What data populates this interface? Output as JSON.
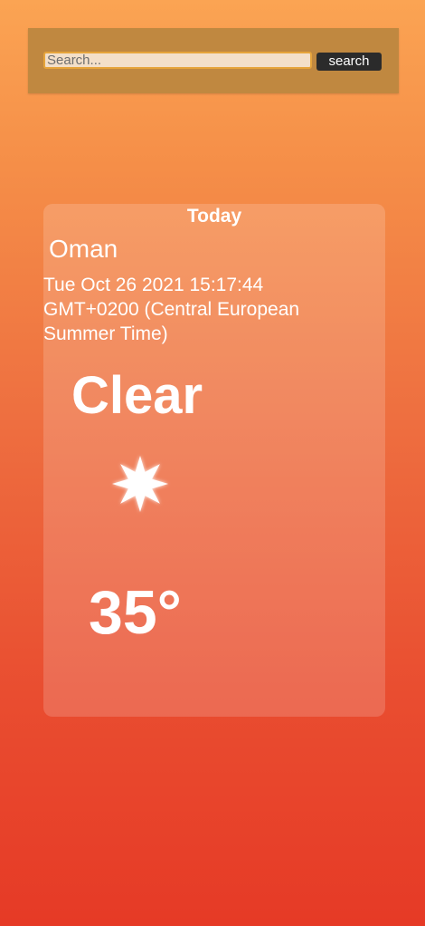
{
  "search": {
    "placeholder": "Search...",
    "value": "",
    "button_label": "search"
  },
  "weather": {
    "heading": "Today",
    "city": "Oman",
    "date": "Tue Oct 26 2021 15:17:44 GMT+0200 (Central European Summer Time)",
    "condition": "Clear",
    "icon": "sun-icon",
    "temperature": "35°"
  },
  "colors": {
    "gradient_top": "#fba453",
    "gradient_bottom": "#e63a26",
    "search_bar_bg": "#c08840",
    "search_input_bg": "#f3dfc9",
    "search_input_border": "#e6a43b",
    "search_button_bg": "#2b2b2b",
    "text": "#ffffff"
  }
}
